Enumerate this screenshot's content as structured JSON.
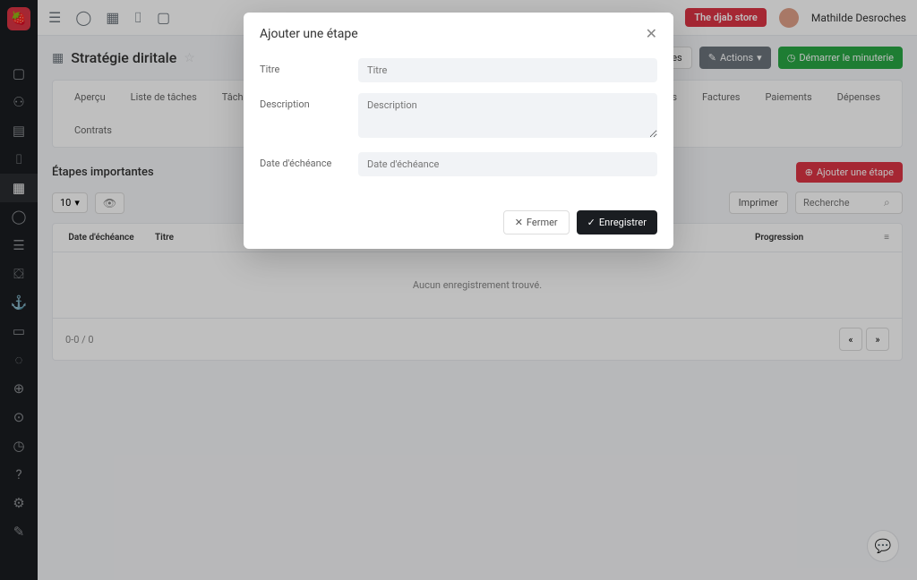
{
  "topbar": {
    "store_label": "The djab store",
    "username": "Mathilde Desroches"
  },
  "page": {
    "title": "Stratégie diritale",
    "tabs": [
      "Aperçu",
      "Liste de tâches",
      "Tâches Kanban",
      "e temps",
      "Factures",
      "Paiements",
      "Dépenses",
      "Contrats"
    ],
    "settings_label": "Paramètres",
    "actions_label": "Actions",
    "timer_label": "Démarrer le minuterie"
  },
  "section": {
    "title": "Étapes importantes",
    "add_label": "Ajouter une étape",
    "page_size": "10",
    "print_label": "Imprimer",
    "search_placeholder": "Recherche"
  },
  "table": {
    "headers": {
      "date": "Date d'échéance",
      "title": "Titre",
      "progress": "Progression"
    },
    "empty": "Aucun enregistrement trouvé.",
    "footer": "0-0 / 0"
  },
  "modal": {
    "title": "Ajouter une étape",
    "labels": {
      "title": "Titre",
      "description": "Description",
      "due": "Date d'échéance"
    },
    "placeholders": {
      "title": "Titre",
      "description": "Description",
      "due": "Date d'échéance"
    },
    "close_label": "Fermer",
    "save_label": "Enregistrer"
  }
}
